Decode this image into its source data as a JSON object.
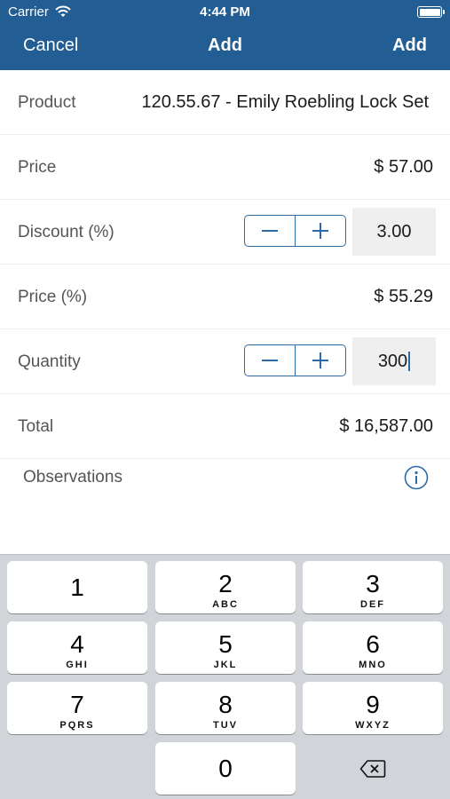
{
  "status_bar": {
    "carrier": "Carrier",
    "time": "4:44 PM",
    "battery_level": 1.0
  },
  "nav": {
    "cancel_label": "Cancel",
    "title": "Add",
    "add_label": "Add"
  },
  "form": {
    "product": {
      "label": "Product",
      "value": "120.55.67 - Emily Roebling Lock Set"
    },
    "price": {
      "label": "Price",
      "value": "$ 57.00"
    },
    "discount": {
      "label": "Discount (%)",
      "value": "3.00"
    },
    "price_pct": {
      "label": "Price (%)",
      "value": "$ 55.29"
    },
    "quantity": {
      "label": "Quantity",
      "value": "300"
    },
    "total": {
      "label": "Total",
      "value": "$ 16,587.00"
    },
    "observations": {
      "label": "Observations"
    }
  },
  "keyboard": {
    "keys": [
      {
        "num": "1",
        "letters": ""
      },
      {
        "num": "2",
        "letters": "ABC"
      },
      {
        "num": "3",
        "letters": "DEF"
      },
      {
        "num": "4",
        "letters": "GHI"
      },
      {
        "num": "5",
        "letters": "JKL"
      },
      {
        "num": "6",
        "letters": "MNO"
      },
      {
        "num": "7",
        "letters": "PQRS"
      },
      {
        "num": "8",
        "letters": "TUV"
      },
      {
        "num": "9",
        "letters": "WXYZ"
      },
      {
        "num": "0",
        "letters": ""
      }
    ]
  },
  "icons": {
    "wifi": "wifi-icon",
    "battery": "battery-icon",
    "minus": "minus-icon",
    "plus": "plus-icon",
    "info": "info-icon",
    "backspace": "backspace-icon"
  },
  "colors": {
    "nav_bar": "#225d93",
    "accent": "#2b6aa6",
    "keyboard_bg": "#d1d4d9",
    "input_bg": "#efeff0"
  }
}
